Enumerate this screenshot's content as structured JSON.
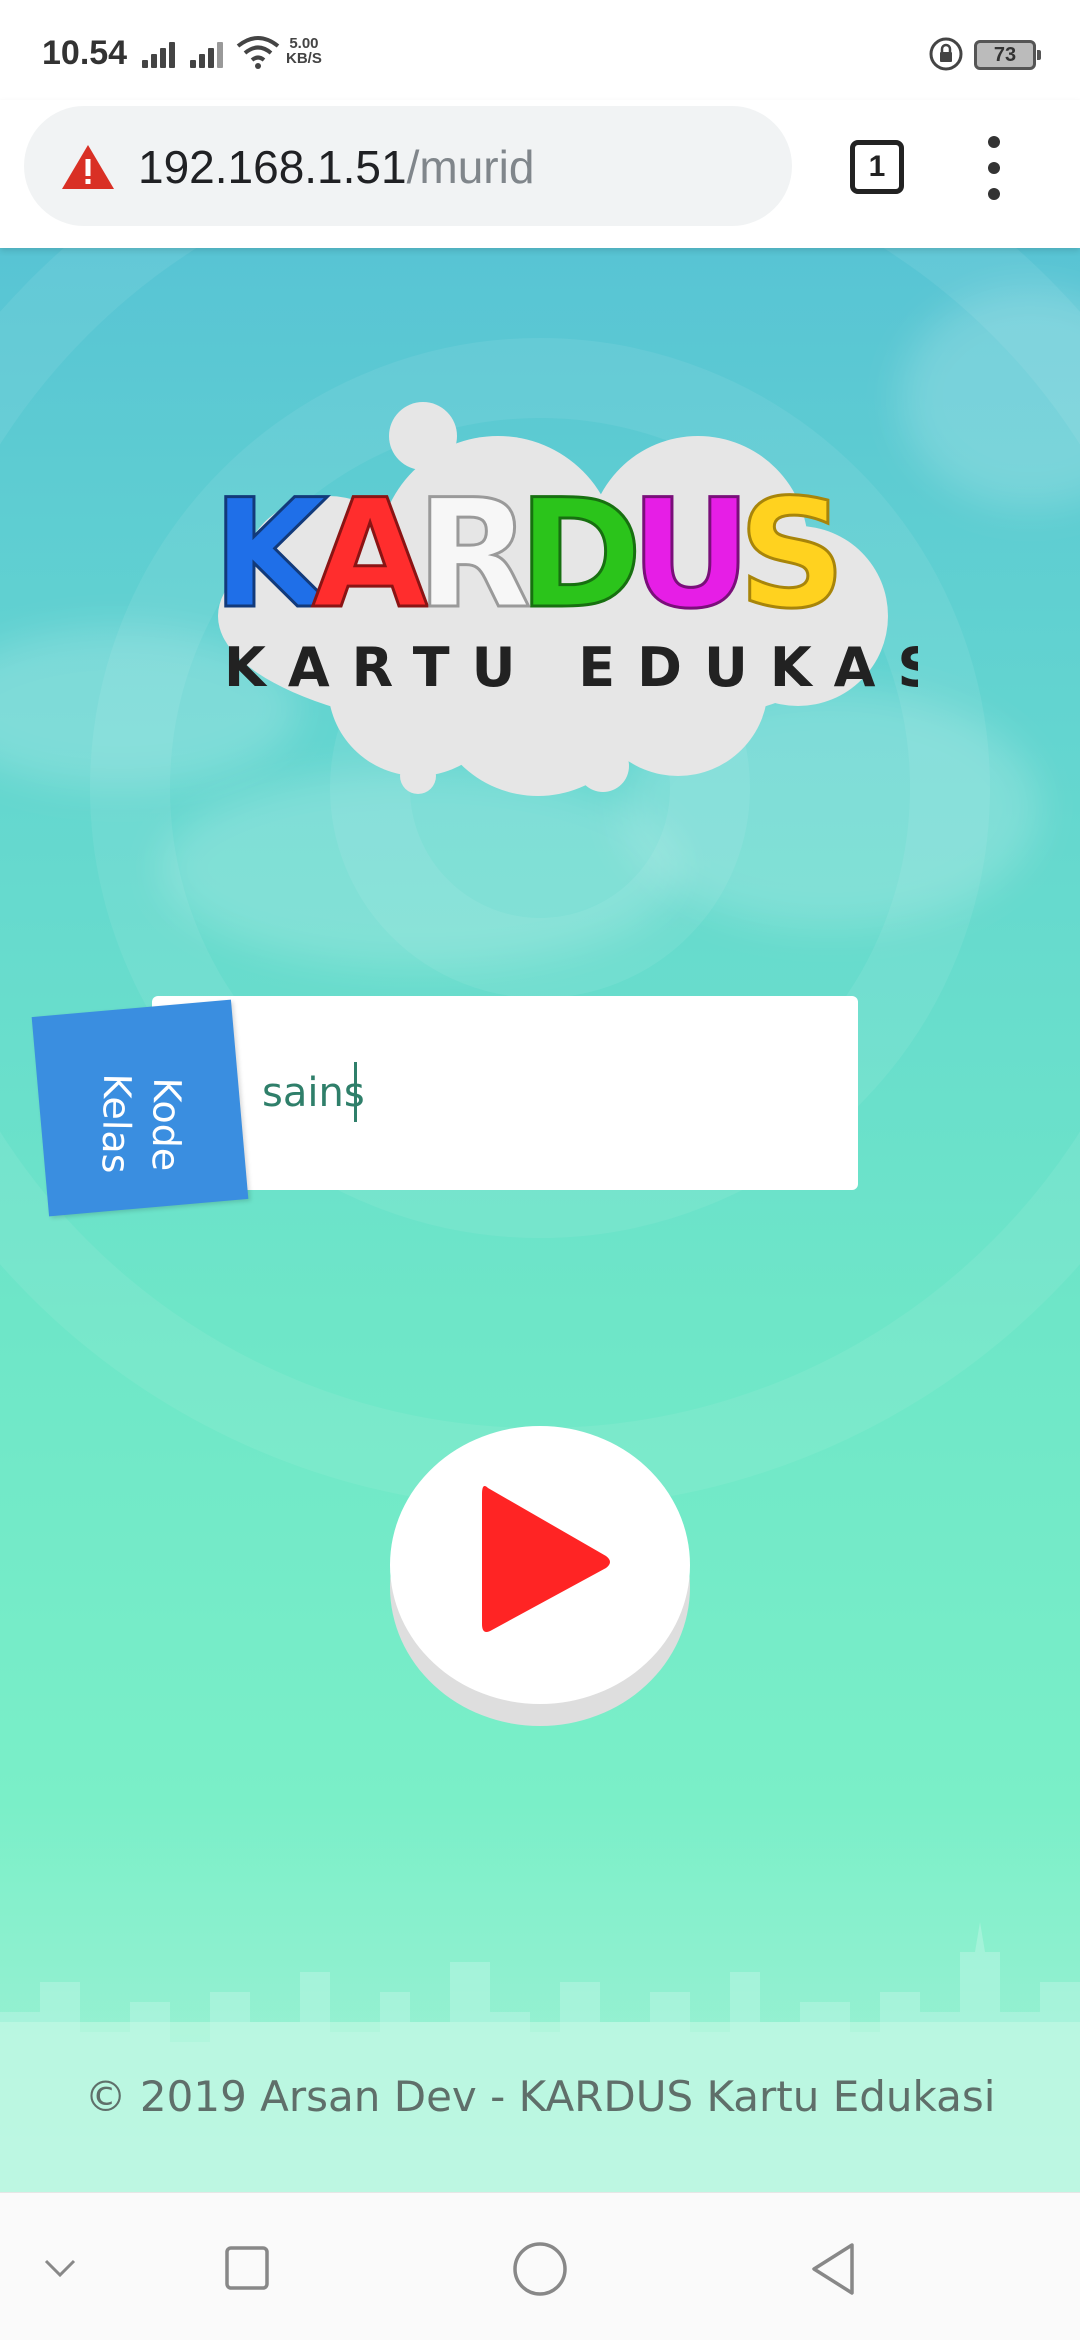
{
  "status_bar": {
    "time": "10.54",
    "network_speed_value": "5.00",
    "network_speed_unit": "KB/S",
    "battery_level": "73"
  },
  "browser": {
    "url_host": "192.168.1.51",
    "url_path": "/murid",
    "tab_count": "1",
    "security_icon": "warning-triangle-icon",
    "menu_icon": "more-vert-icon"
  },
  "page": {
    "logo": {
      "title_letters": [
        "K",
        "A",
        "R",
        "D",
        "U",
        "S"
      ],
      "title_colors": [
        "#1f6fe8",
        "#ff2d2d",
        "#f2f2f2",
        "#2bc41b",
        "#e61ee6",
        "#ffd21f"
      ],
      "subtitle": "KARTU EDUKASI"
    },
    "code_field": {
      "label": "Kode\nKelas",
      "value": "sains"
    },
    "play_button_icon": "play-icon",
    "play_color": "#ff2424",
    "footer": "© 2019 Arsan Dev - KARDUS Kartu Edukasi"
  },
  "nav_bar": {
    "icons": [
      "chevron-down-icon",
      "recents-icon",
      "home-icon",
      "back-icon"
    ]
  }
}
